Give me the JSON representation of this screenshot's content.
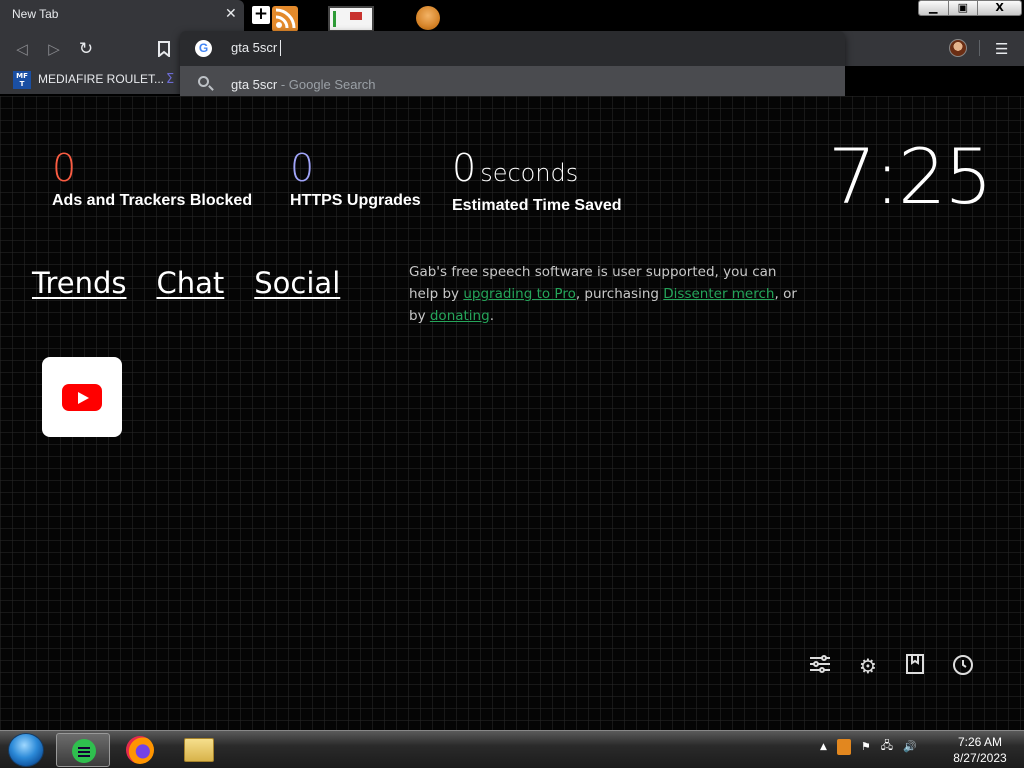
{
  "browser": {
    "tab_title": "New Tab",
    "tab_close": "✕",
    "new_tab": "+",
    "window_controls": {
      "minimize": "▁",
      "restore": "▣",
      "close": "X"
    },
    "omnibox": {
      "value": "gta 5scr",
      "suggestion_query": "gta 5scr",
      "suggestion_engine": " - Google Search"
    },
    "bookmarks": [
      {
        "icon_text": "MF\nT",
        "label": "MEDIAFIRE ROULET..."
      }
    ],
    "menu_icon": "☰"
  },
  "stats": {
    "ads": {
      "value": "0",
      "label": "Ads and Trackers Blocked"
    },
    "https": {
      "value": "0",
      "label": "HTTPS Upgrades"
    },
    "time": {
      "value": "0",
      "unit": "seconds",
      "label": "Estimated Time Saved"
    }
  },
  "clock": "7:25",
  "links": [
    "Trends",
    "Chat",
    "Social"
  ],
  "gab": {
    "part1": "Gab's free speech software is user supported, you can help by ",
    "link1": "upgrading to Pro",
    "part2": ", purchasing ",
    "link2": "Dissenter merch",
    "part3": ", or by ",
    "link3": "donating",
    "part4": "."
  },
  "taskbar": {
    "time": "7:26 AM",
    "date": "8/27/2023"
  },
  "colors": {
    "ads_number": "#fa5c42",
    "https_number": "#a0a4f8",
    "gab_link": "#25a55a"
  }
}
